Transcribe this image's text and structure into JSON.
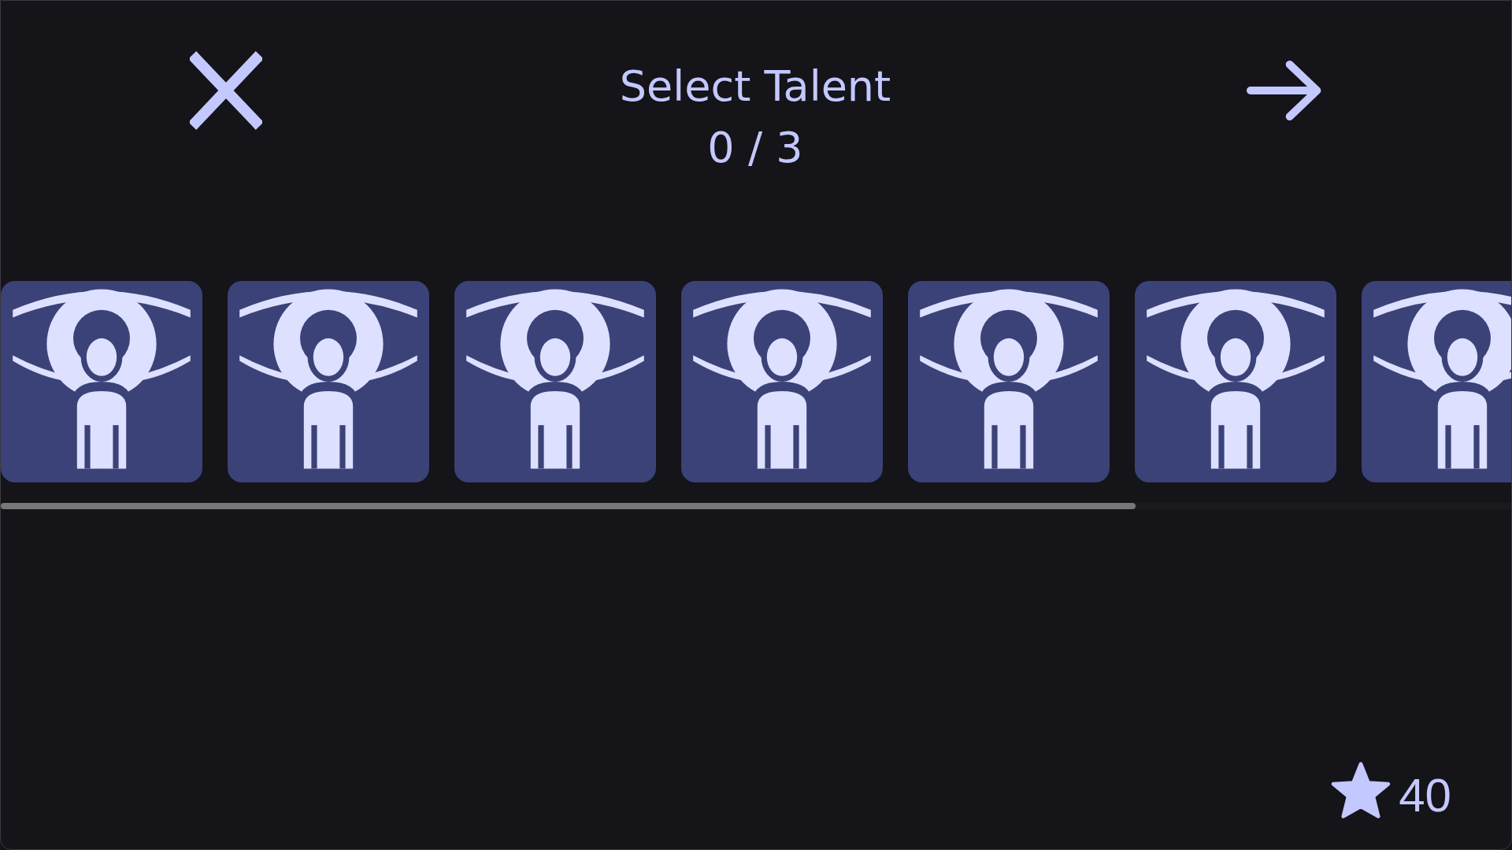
{
  "header": {
    "title": "Select Talent",
    "counter": "0 / 3"
  },
  "talents": [
    {
      "selected": false
    },
    {
      "selected": false
    },
    {
      "selected": false
    },
    {
      "selected": false
    },
    {
      "selected": false
    },
    {
      "selected": false
    },
    {
      "selected": false
    }
  ],
  "currency": {
    "amount": "40"
  }
}
